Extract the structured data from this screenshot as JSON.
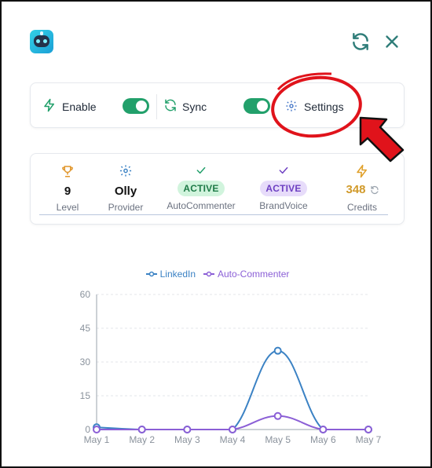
{
  "header": {
    "refresh_icon": "refresh-icon",
    "close_icon": "close-icon"
  },
  "controls": {
    "enable_label": "Enable",
    "enable_on": true,
    "sync_label": "Sync",
    "sync_on": true,
    "settings_label": "Settings"
  },
  "stats": {
    "level": {
      "value": "9",
      "label": "Level"
    },
    "provider": {
      "value": "Olly",
      "label": "Provider"
    },
    "autocommenter": {
      "value": "ACTIVE",
      "label": "AutoCommenter"
    },
    "brandvoice": {
      "value": "ACTIVE",
      "label": "BrandVoice"
    },
    "credits": {
      "value": "348",
      "label": "Credits"
    }
  },
  "colors": {
    "accent_green": "#22a06b",
    "linkedin_series": "#3b82c4",
    "autocommenter_series": "#8b5fd6",
    "credits": "#d19a2a",
    "annotation_red": "#e0131b"
  },
  "chart_data": {
    "type": "line",
    "categories": [
      "May 1",
      "May 2",
      "May 3",
      "May 4",
      "May 5",
      "May 6",
      "May 7"
    ],
    "series": [
      {
        "name": "LinkedIn",
        "values": [
          1,
          0,
          0,
          0,
          35,
          0,
          0
        ],
        "color": "#3b82c4"
      },
      {
        "name": "Auto-Commenter",
        "values": [
          0,
          0,
          0,
          0,
          6,
          0,
          0
        ],
        "color": "#8b5fd6"
      }
    ],
    "yticks": [
      "60",
      "45",
      "30",
      "15",
      "0"
    ],
    "ylim": [
      0,
      60
    ],
    "grid": true,
    "legend": "top-center"
  }
}
